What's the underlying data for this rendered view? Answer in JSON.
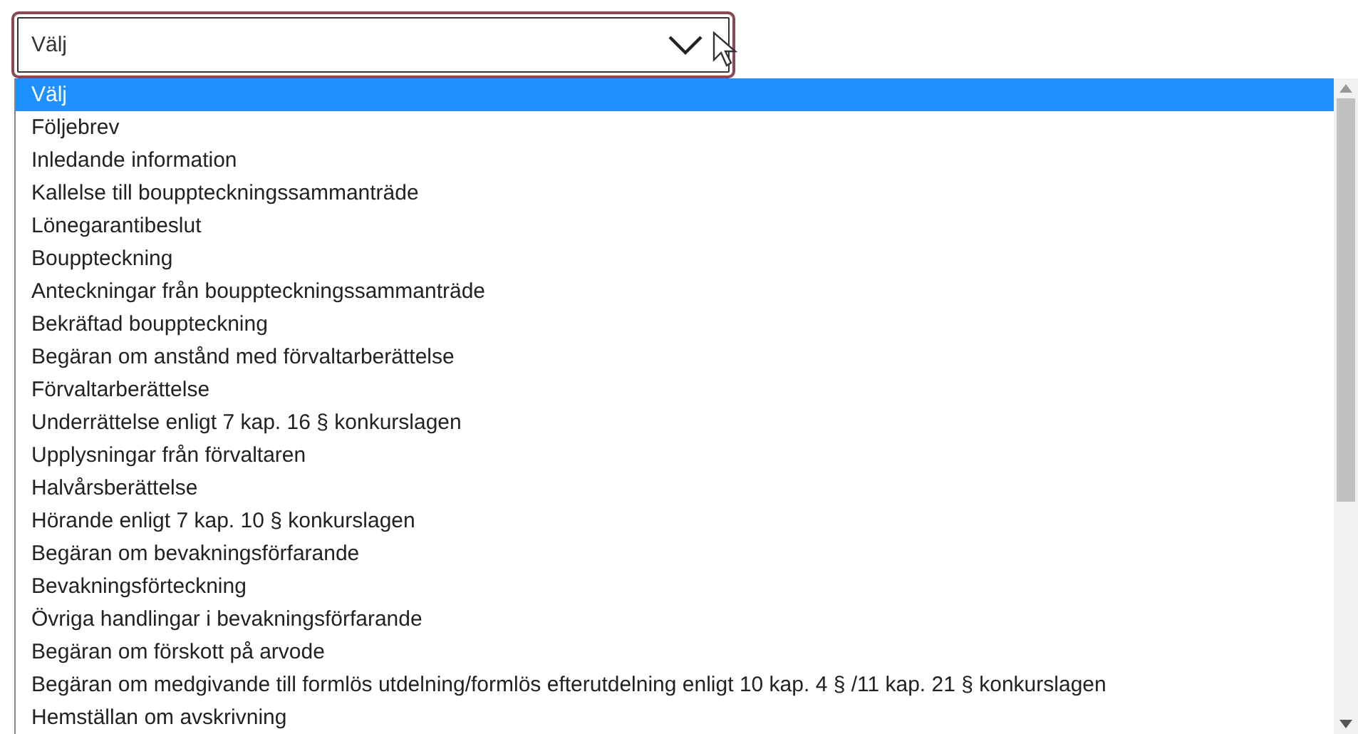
{
  "select": {
    "value": "Välj"
  },
  "options": [
    {
      "label": "Välj",
      "selected": true
    },
    {
      "label": "Följebrev",
      "selected": false
    },
    {
      "label": "Inledande information",
      "selected": false
    },
    {
      "label": "Kallelse till bouppteckningssammanträde",
      "selected": false
    },
    {
      "label": "Lönegarantibeslut",
      "selected": false
    },
    {
      "label": "Bouppteckning",
      "selected": false
    },
    {
      "label": "Anteckningar från bouppteckningssammanträde",
      "selected": false
    },
    {
      "label": "Bekräftad bouppteckning",
      "selected": false
    },
    {
      "label": "Begäran om anstånd med förvaltarberättelse",
      "selected": false
    },
    {
      "label": "Förvaltarberättelse",
      "selected": false
    },
    {
      "label": "Underrättelse enligt 7 kap. 16 § konkurslagen",
      "selected": false
    },
    {
      "label": "Upplysningar från förvaltaren",
      "selected": false
    },
    {
      "label": "Halvårsberättelse",
      "selected": false
    },
    {
      "label": "Hörande enligt 7 kap. 10 § konkurslagen",
      "selected": false
    },
    {
      "label": "Begäran om bevakningsförfarande",
      "selected": false
    },
    {
      "label": "Bevakningsförteckning",
      "selected": false
    },
    {
      "label": "Övriga handlingar i bevakningsförfarande",
      "selected": false
    },
    {
      "label": "Begäran om förskott på arvode",
      "selected": false
    },
    {
      "label": "Begäran om medgivande till formlös utdelning/formlös efterutdelning enligt 10 kap. 4 § /11 kap. 21 § konkurslagen",
      "selected": false
    },
    {
      "label": "Hemställan om avskrivning",
      "selected": false
    }
  ]
}
